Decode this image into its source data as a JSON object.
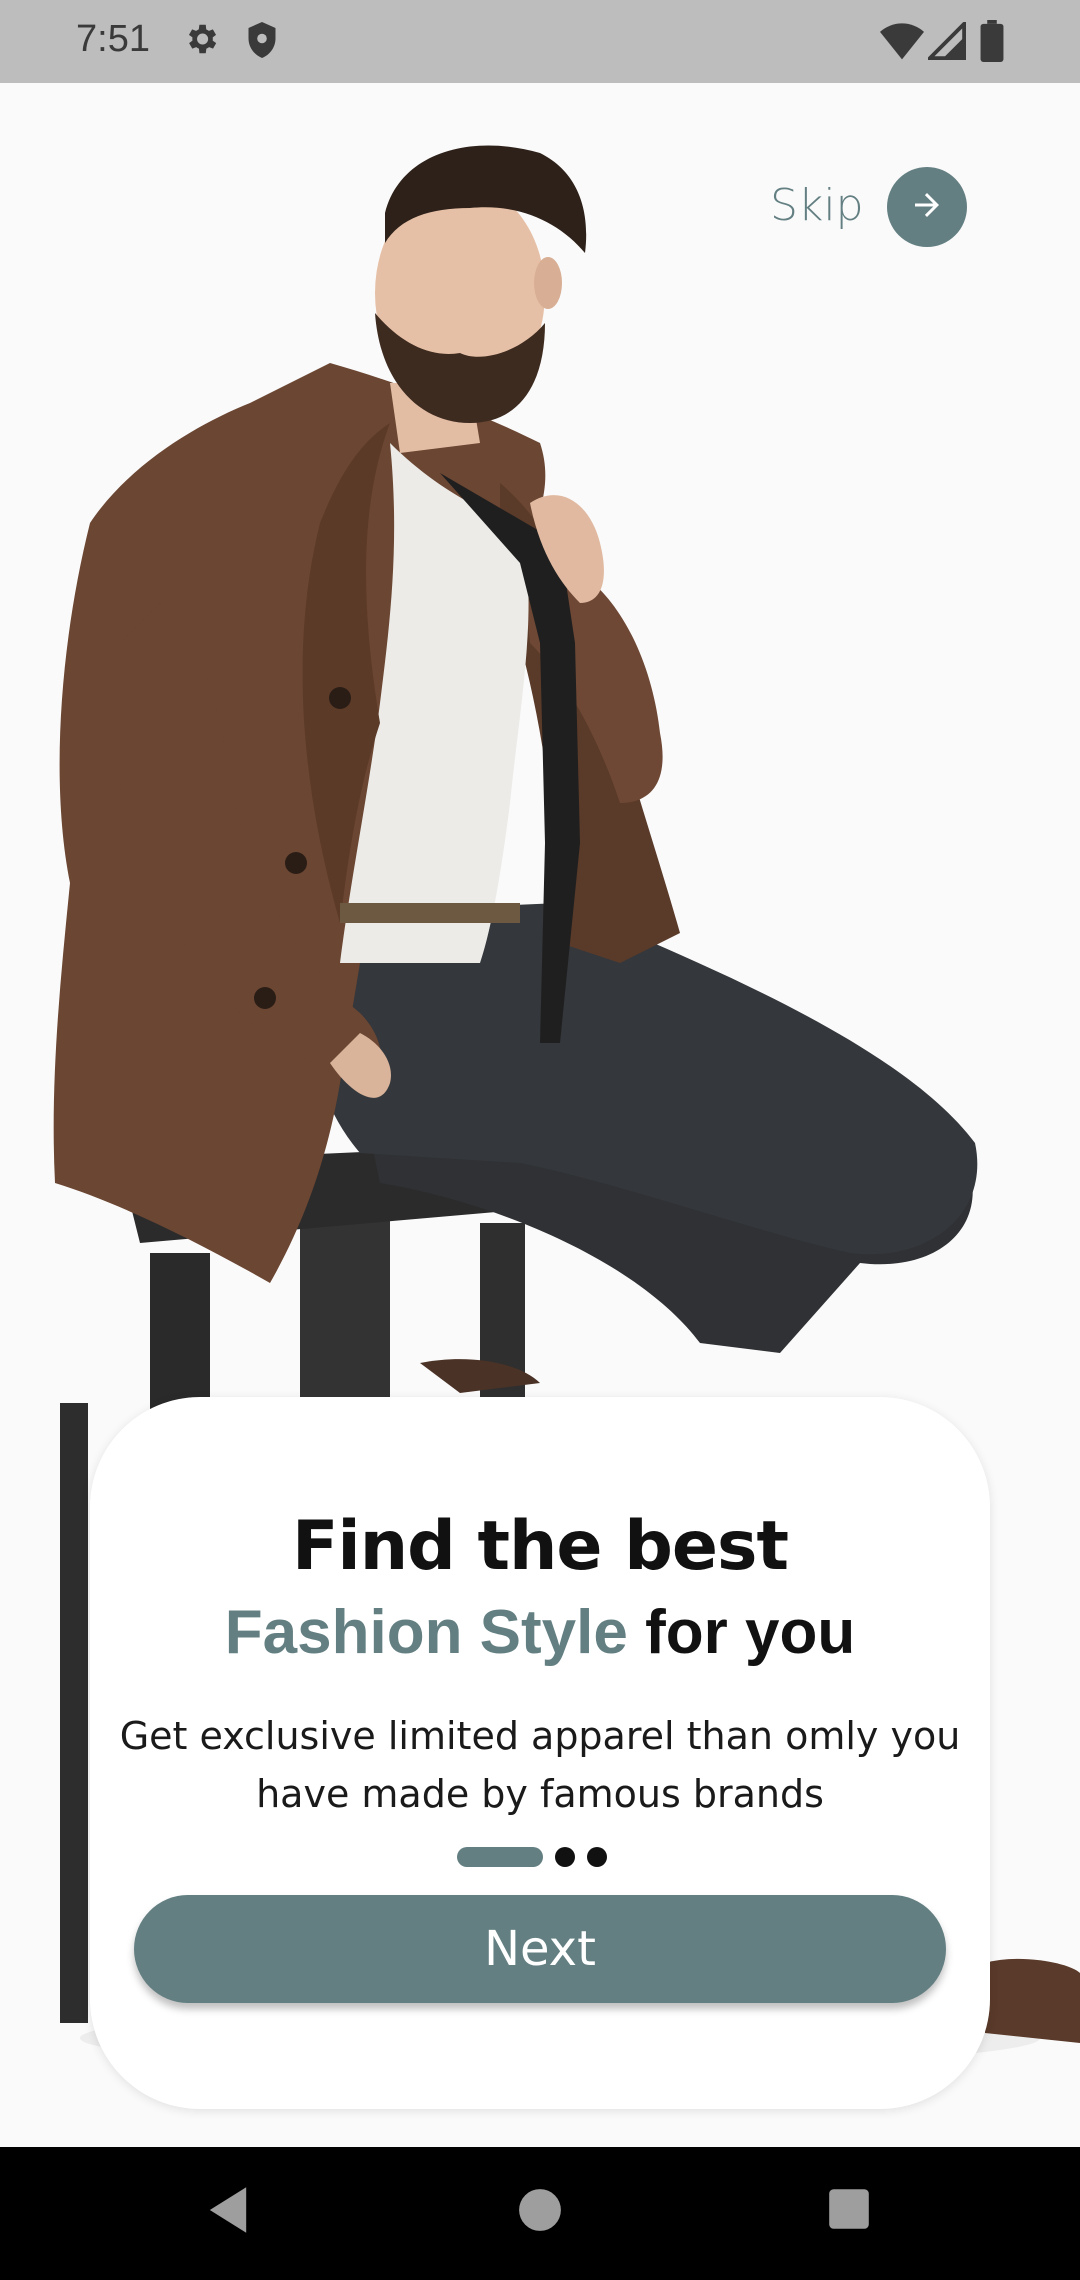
{
  "status_bar": {
    "time": "7:51",
    "icons": [
      "settings-icon",
      "shield-icon",
      "wifi-icon",
      "signal-icon",
      "battery-icon"
    ]
  },
  "hero": {
    "image": "man-in-brown-coat-sitting-on-stool-photo"
  },
  "skip": {
    "label": "Skip",
    "icon": "arrow-right-icon"
  },
  "card": {
    "title_line_1": "Find the best",
    "title_accent": "Fashion Style",
    "title_rest": " for you",
    "subtitle": "Get exclusive limited apparel than omly you have made by famous brands",
    "pager": {
      "current": 1,
      "total": 3
    },
    "next_label": "Next"
  },
  "nav_bar": {
    "icons": [
      "back-icon",
      "home-icon",
      "recents-icon"
    ]
  },
  "colors": {
    "accent": "#637f82",
    "status_bar": "#bdbdbd",
    "nav_bar": "#000000",
    "coat": "#6b4632",
    "pants": "#2f3134"
  }
}
